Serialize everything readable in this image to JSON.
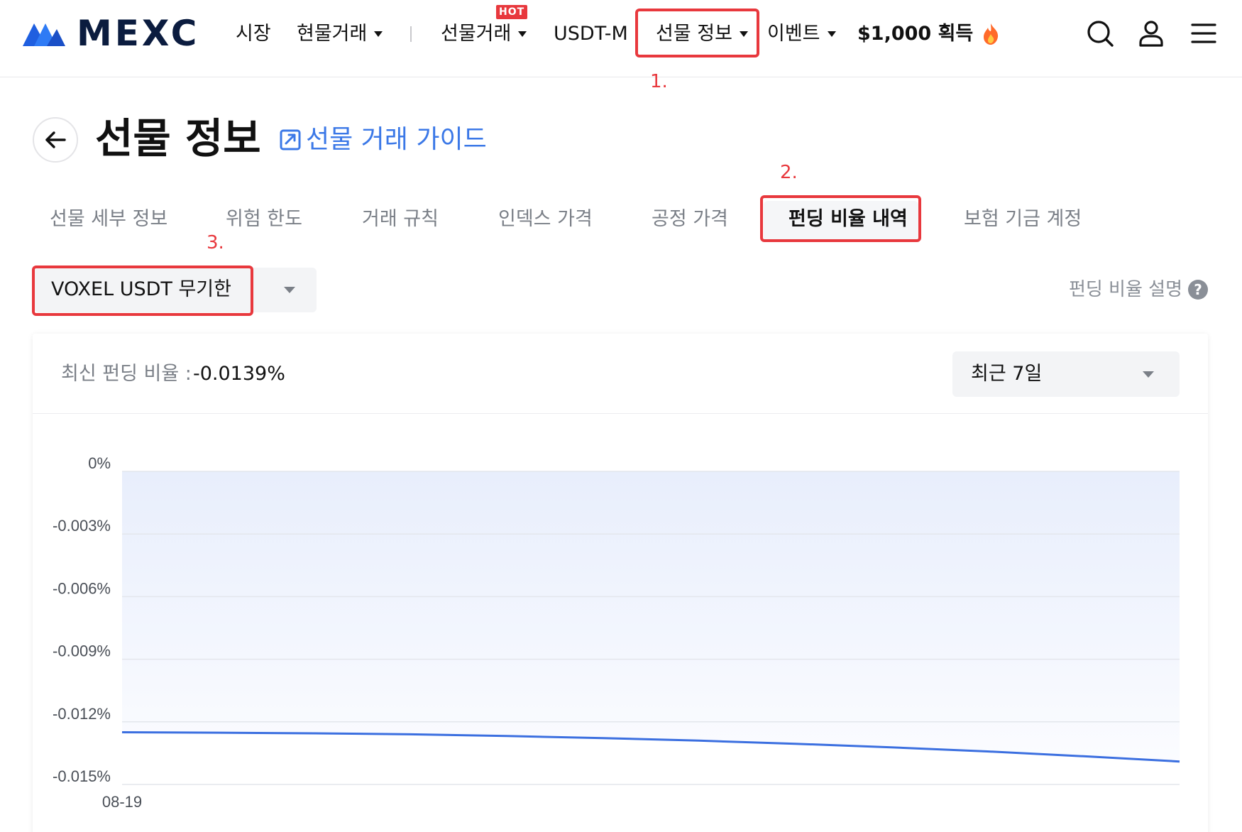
{
  "header": {
    "logo_text": "MEXC",
    "nav": {
      "market": "시장",
      "spot": "현물거래",
      "futures": "선물거래",
      "hot_badge": "HOT",
      "usdt_m": "USDT-M",
      "futures_info": "선물 정보",
      "events": "이벤트",
      "reward": "$1,000 획득"
    },
    "icons": [
      "search-icon",
      "user-icon",
      "menu-icon",
      "fire-icon",
      "caret-down-icon"
    ]
  },
  "annotations": [
    "1.",
    "2.",
    "3."
  ],
  "page": {
    "title": "선물 정보",
    "guide_link": "선물 거래 가이드"
  },
  "tabs": [
    {
      "label": "선물 세부 정보",
      "active": false
    },
    {
      "label": "위험 한도",
      "active": false
    },
    {
      "label": "거래 규칙",
      "active": false
    },
    {
      "label": "인덱스 가격",
      "active": false
    },
    {
      "label": "공정 가격",
      "active": false
    },
    {
      "label": "펀딩 비율 내역",
      "active": true
    },
    {
      "label": "보험 기금 계정",
      "active": false
    }
  ],
  "contract_selector": {
    "selected": "VOXEL USDT 무기한"
  },
  "funding_explain": "펀딩 비율 설명",
  "card": {
    "latest_label": "최신 펀딩 비율 :",
    "latest_value": "-0.0139%",
    "period": "최근 7일"
  },
  "colors": {
    "brand_blue": "#1f5fe0",
    "link_blue": "#3b78e7",
    "annotation_red": "#e8383d",
    "line_blue": "#3b6fe0",
    "area_fill": "#e8eefc"
  },
  "chart_data": {
    "type": "area",
    "ylim": [
      -0.015,
      0
    ],
    "yticks": [
      "0%",
      "-0.003%",
      "-0.006%",
      "-0.009%",
      "-0.012%",
      "-0.015%"
    ],
    "ytick_values": [
      0,
      -0.003,
      -0.006,
      -0.009,
      -0.012,
      -0.015
    ],
    "xticks": [
      "08-19"
    ],
    "series": [
      {
        "values": [
          -0.0125,
          -0.01252,
          -0.01255,
          -0.0126,
          -0.01268,
          -0.01278,
          -0.0129,
          -0.01305,
          -0.01322,
          -0.01342,
          -0.01365,
          -0.0139
        ]
      }
    ],
    "grid": true
  }
}
